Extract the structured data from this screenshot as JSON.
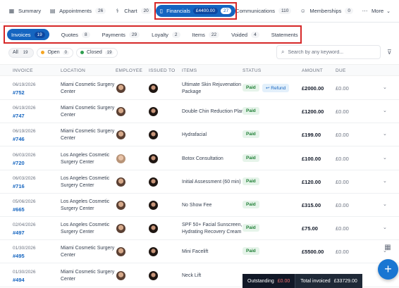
{
  "nav": {
    "summary": "Summary",
    "appointments": {
      "label": "Appointments",
      "count": "26"
    },
    "chart": {
      "label": "Chart",
      "count": "20"
    },
    "financials": {
      "label": "Financials",
      "amount": "£4400.00",
      "count": "27"
    },
    "communications": {
      "label": "Communications",
      "count": "110"
    },
    "memberships": {
      "label": "Memberships",
      "count": "0"
    },
    "more": "More"
  },
  "subtabs": [
    {
      "label": "Invoices",
      "count": "19"
    },
    {
      "label": "Quotes",
      "count": "8"
    },
    {
      "label": "Payments",
      "count": "29"
    },
    {
      "label": "Loyalty",
      "count": "2"
    },
    {
      "label": "Items",
      "count": "22"
    },
    {
      "label": "Voided",
      "count": "4"
    },
    {
      "label": "Statements",
      "count": ""
    }
  ],
  "filters": [
    {
      "label": "All",
      "count": "19"
    },
    {
      "label": "Open",
      "count": "0"
    },
    {
      "label": "Closed",
      "count": "19"
    }
  ],
  "colors": {
    "primary": "#1565c0",
    "open_dot": "#f5a623",
    "closed_dot": "#2e9e4f",
    "paid_bg": "#e6f4ea"
  },
  "search": {
    "placeholder": "Search by any keyword..."
  },
  "columns": [
    "INVOICE",
    "LOCATION",
    "EMPLOYEE",
    "ISSUED TO",
    "ITEMS",
    "STATUS",
    "AMOUNT",
    "DUE"
  ],
  "rows": [
    {
      "date": "06/19/2026",
      "num": "#752",
      "loc1": "Miami Cosmetic Surgery",
      "loc2": "Center",
      "item1": "Ultimate Skin Rejuvenation",
      "item2": "Package",
      "status": "Paid",
      "extra": "Refund",
      "amount": "£2000.00",
      "due": "£0.00"
    },
    {
      "date": "06/19/2026",
      "num": "#747",
      "loc1": "Miami Cosmetic Surgery",
      "loc2": "Center",
      "item1": "Double Chin Reduction Plan",
      "item2": "",
      "status": "Paid",
      "extra": "",
      "amount": "£1200.00",
      "due": "£0.00"
    },
    {
      "date": "06/19/2026",
      "num": "#746",
      "loc1": "Miami Cosmetic Surgery",
      "loc2": "Center",
      "item1": "Hydrafacial",
      "item2": "",
      "status": "Paid",
      "extra": "",
      "amount": "£199.00",
      "due": "£0.00"
    },
    {
      "date": "06/03/2026",
      "num": "#720",
      "loc1": "Los Angeles Cosmetic",
      "loc2": "Surgery Center",
      "item1": "Botox Consultation",
      "item2": "",
      "status": "Paid",
      "extra": "",
      "amount": "£100.00",
      "due": "£0.00"
    },
    {
      "date": "06/03/2026",
      "num": "#716",
      "loc1": "Los Angeles Cosmetic",
      "loc2": "Surgery Center",
      "item1": "Initial Assessment (60 min)",
      "item2": "",
      "status": "Paid",
      "extra": "",
      "amount": "£120.00",
      "due": "£0.00"
    },
    {
      "date": "05/06/2026",
      "num": "#665",
      "loc1": "Los Angeles Cosmetic",
      "loc2": "Surgery Center",
      "item1": "No Show Fee",
      "item2": "",
      "status": "Paid",
      "extra": "",
      "amount": "£315.00",
      "due": "£0.00"
    },
    {
      "date": "02/04/2026",
      "num": "#497",
      "loc1": "Los Angeles Cosmetic",
      "loc2": "Surgery Center",
      "item1": "SPF 50+ Facial Sunscreen,",
      "item2": "Hydrating Recovery Cream",
      "status": "Paid",
      "extra": "",
      "amount": "£75.00",
      "due": "£0.00"
    },
    {
      "date": "01/30/2026",
      "num": "#495",
      "loc1": "Miami Cosmetic Surgery",
      "loc2": "Center",
      "item1": "Mini Facelift",
      "item2": "",
      "status": "Paid",
      "extra": "",
      "amount": "£5500.00",
      "due": "£0.00"
    },
    {
      "date": "01/30/2026",
      "num": "#494",
      "loc1": "Miami Cosmetic Surgery",
      "loc2": "Center",
      "item1": "Neck Lift",
      "item2": "",
      "status": "",
      "extra": "",
      "amount": "",
      "due": ""
    }
  ],
  "totals": {
    "outstanding_label": "Outstanding",
    "outstanding_value": "£0.00",
    "total_label": "Total invoiced",
    "total_value": "£33729.00"
  }
}
